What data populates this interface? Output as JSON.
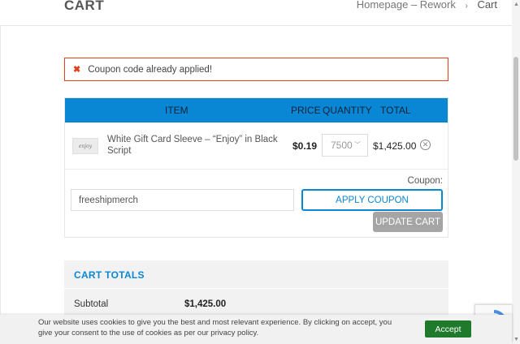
{
  "header": {
    "title": "CART",
    "breadcrumb": {
      "home": "Homepage – Rework",
      "separator": "›",
      "current": "Cart"
    }
  },
  "notice": {
    "icon": "close-icon",
    "message": "Coupon code already applied!",
    "color": "#e2401c"
  },
  "table": {
    "columns": {
      "item": "ITEM",
      "price": "PRICE",
      "quantity": "QUANTITY",
      "total": "TOTAL"
    },
    "header_color": "#0a87d4",
    "rows": [
      {
        "thumb_text": "enjoy",
        "name": "White Gift Card Sleeve – “Enjoy” in Black Script",
        "price": "$0.19",
        "quantity": "7500",
        "total": "$1,425.00"
      }
    ]
  },
  "coupon": {
    "label": "Coupon:",
    "value": "freeshipmerch",
    "apply_label": "APPLY COUPON",
    "update_label": "UPDATE CART"
  },
  "totals": {
    "title": "CART TOTALS",
    "subtotal_label": "Subtotal",
    "subtotal_value": "$1,425.00"
  },
  "cookie": {
    "text": "Our website uses cookies to give you the best and most relevant experience. By clicking on accept, you give your consent to the use of cookies as per our privacy policy.",
    "accept_label": "Accept",
    "accept_color": "#1f7a2c"
  }
}
